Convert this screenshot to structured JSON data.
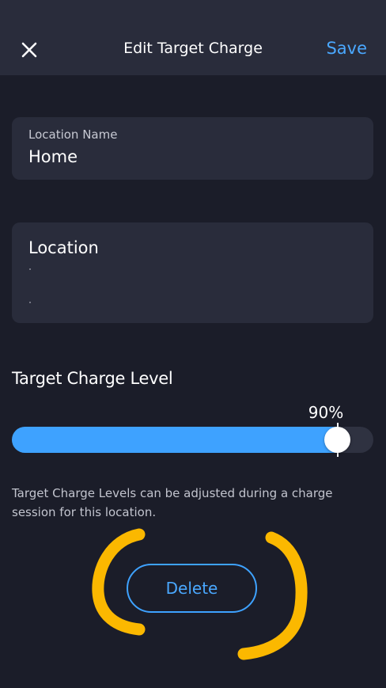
{
  "header": {
    "title": "Edit Target Charge",
    "save_label": "Save",
    "close_icon": "close-icon"
  },
  "location_name": {
    "label": "Location Name",
    "value": "Home"
  },
  "location": {
    "title": "Location"
  },
  "target_charge": {
    "title": "Target Charge Level",
    "value_label": "90%",
    "percent": 90
  },
  "helper_text": "Target Charge Levels can be adjusted during a charge session for this location.",
  "delete_label": "Delete",
  "colors": {
    "background": "#1b1d29",
    "header": "#292c3b",
    "accent": "#3ea2ff",
    "annotation": "#fbb800"
  }
}
